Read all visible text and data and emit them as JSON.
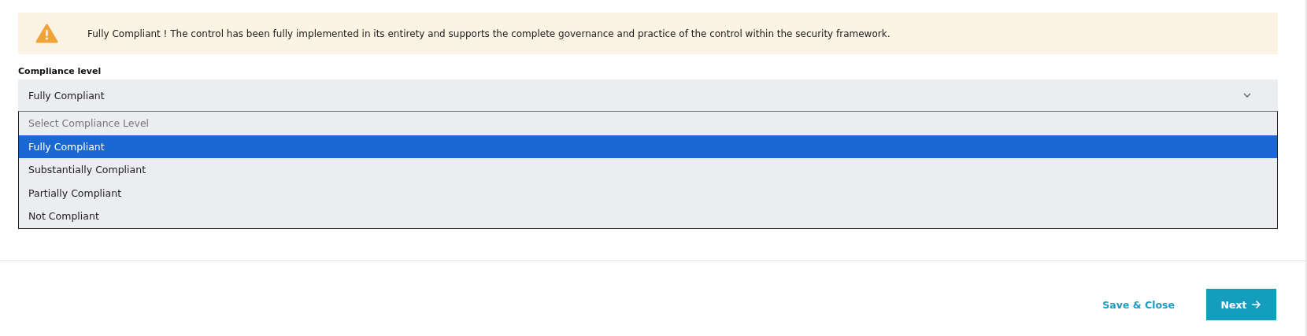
{
  "alert": {
    "message": "Fully Compliant ! The control has been fully implemented in its entirety and supports the complete governance and practice of the control within the security framework."
  },
  "compliance_level": {
    "label": "Compliance level",
    "value": "Fully Compliant",
    "expanded": true,
    "options": [
      {
        "label": "Select Compliance Level",
        "kind": "placeholder",
        "selected": false
      },
      {
        "label": "Fully Compliant",
        "kind": "option",
        "selected": true
      },
      {
        "label": "Substantially Compliant",
        "kind": "option",
        "selected": false
      },
      {
        "label": "Partially Compliant",
        "kind": "option",
        "selected": false
      },
      {
        "label": "Not Compliant",
        "kind": "option",
        "selected": false
      }
    ]
  },
  "footer": {
    "save_close": "Save & Close",
    "next": "Next"
  }
}
